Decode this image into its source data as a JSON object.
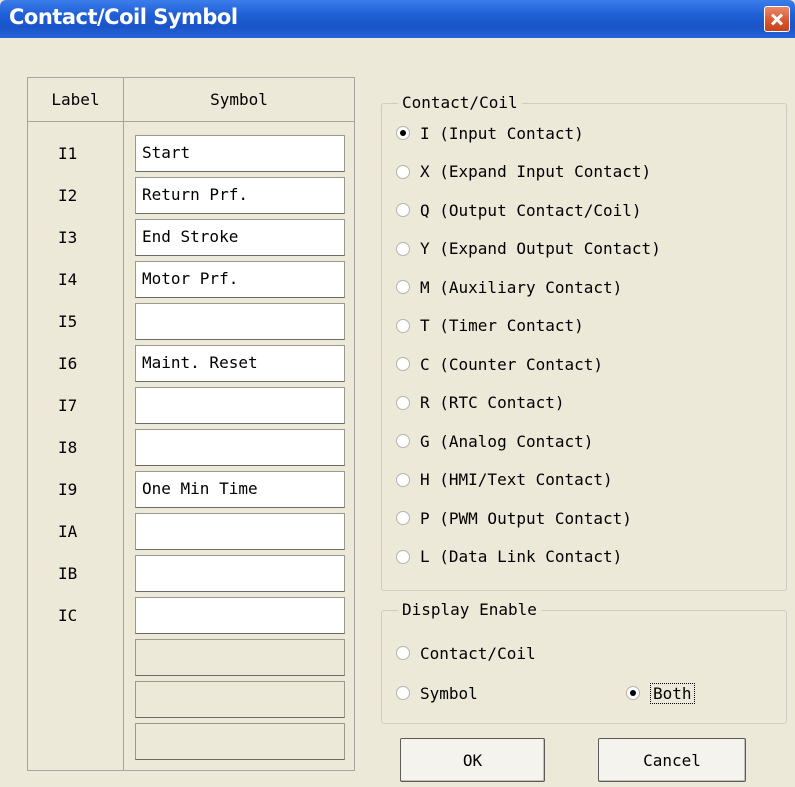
{
  "window": {
    "title": "Contact/Coil Symbol"
  },
  "table": {
    "label_header": "Label",
    "symbol_header": "Symbol",
    "rows": [
      {
        "label": "I1",
        "symbol": "Start"
      },
      {
        "label": "I2",
        "symbol": "Return Prf."
      },
      {
        "label": "I3",
        "symbol": "End Stroke"
      },
      {
        "label": "I4",
        "symbol": "Motor Prf."
      },
      {
        "label": "I5",
        "symbol": ""
      },
      {
        "label": "I6",
        "symbol": "Maint. Reset"
      },
      {
        "label": "I7",
        "symbol": ""
      },
      {
        "label": "I8",
        "symbol": ""
      },
      {
        "label": "I9",
        "symbol": "One Min Time"
      },
      {
        "label": "IA",
        "symbol": ""
      },
      {
        "label": "IB",
        "symbol": ""
      },
      {
        "label": "IC",
        "symbol": ""
      },
      {
        "label": "",
        "symbol": ""
      },
      {
        "label": "",
        "symbol": ""
      },
      {
        "label": "",
        "symbol": ""
      }
    ]
  },
  "contact_coil": {
    "legend": "Contact/Coil",
    "selected": "I",
    "options": [
      "I (Input Contact)",
      "X (Expand Input Contact)",
      "Q (Output Contact/Coil)",
      "Y (Expand Output Contact)",
      "M (Auxiliary Contact)",
      "T (Timer Contact)",
      "C (Counter Contact)",
      "R (RTC Contact)",
      "G (Analog Contact)",
      "H (HMI/Text Contact)",
      "P (PWM Output Contact)",
      "L (Data Link Contact)"
    ]
  },
  "display_enable": {
    "legend": "Display Enable",
    "contact_coil": "Contact/Coil",
    "symbol": "Symbol",
    "both": "Both",
    "selected": "Both"
  },
  "buttons": {
    "ok": "OK",
    "cancel": "Cancel"
  }
}
